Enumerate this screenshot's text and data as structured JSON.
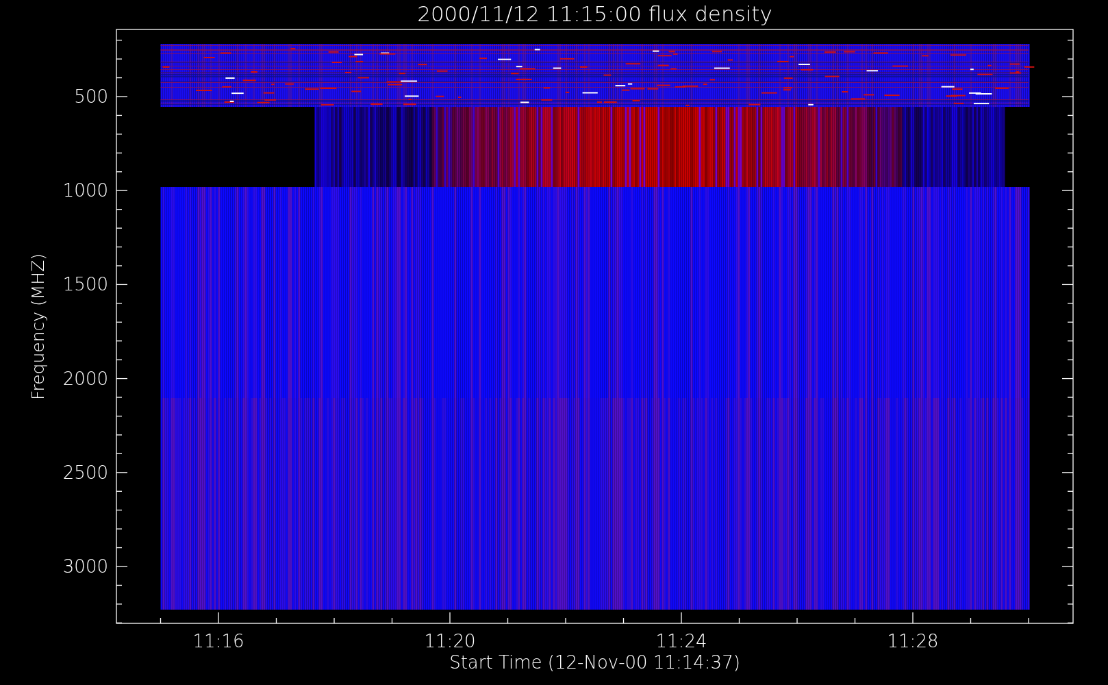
{
  "title": "2000/11/12 11:15:00 flux density",
  "plot": {
    "ylabel": "Frequency (MHZ)",
    "xlabel": "Start Time (12-Nov-00 11:14:37)",
    "yticks": [
      "500",
      "1000",
      "1500",
      "2000",
      "2500",
      "3000"
    ],
    "xticks": [
      "11:16",
      "11:20",
      "11:24",
      "11:28"
    ]
  }
}
